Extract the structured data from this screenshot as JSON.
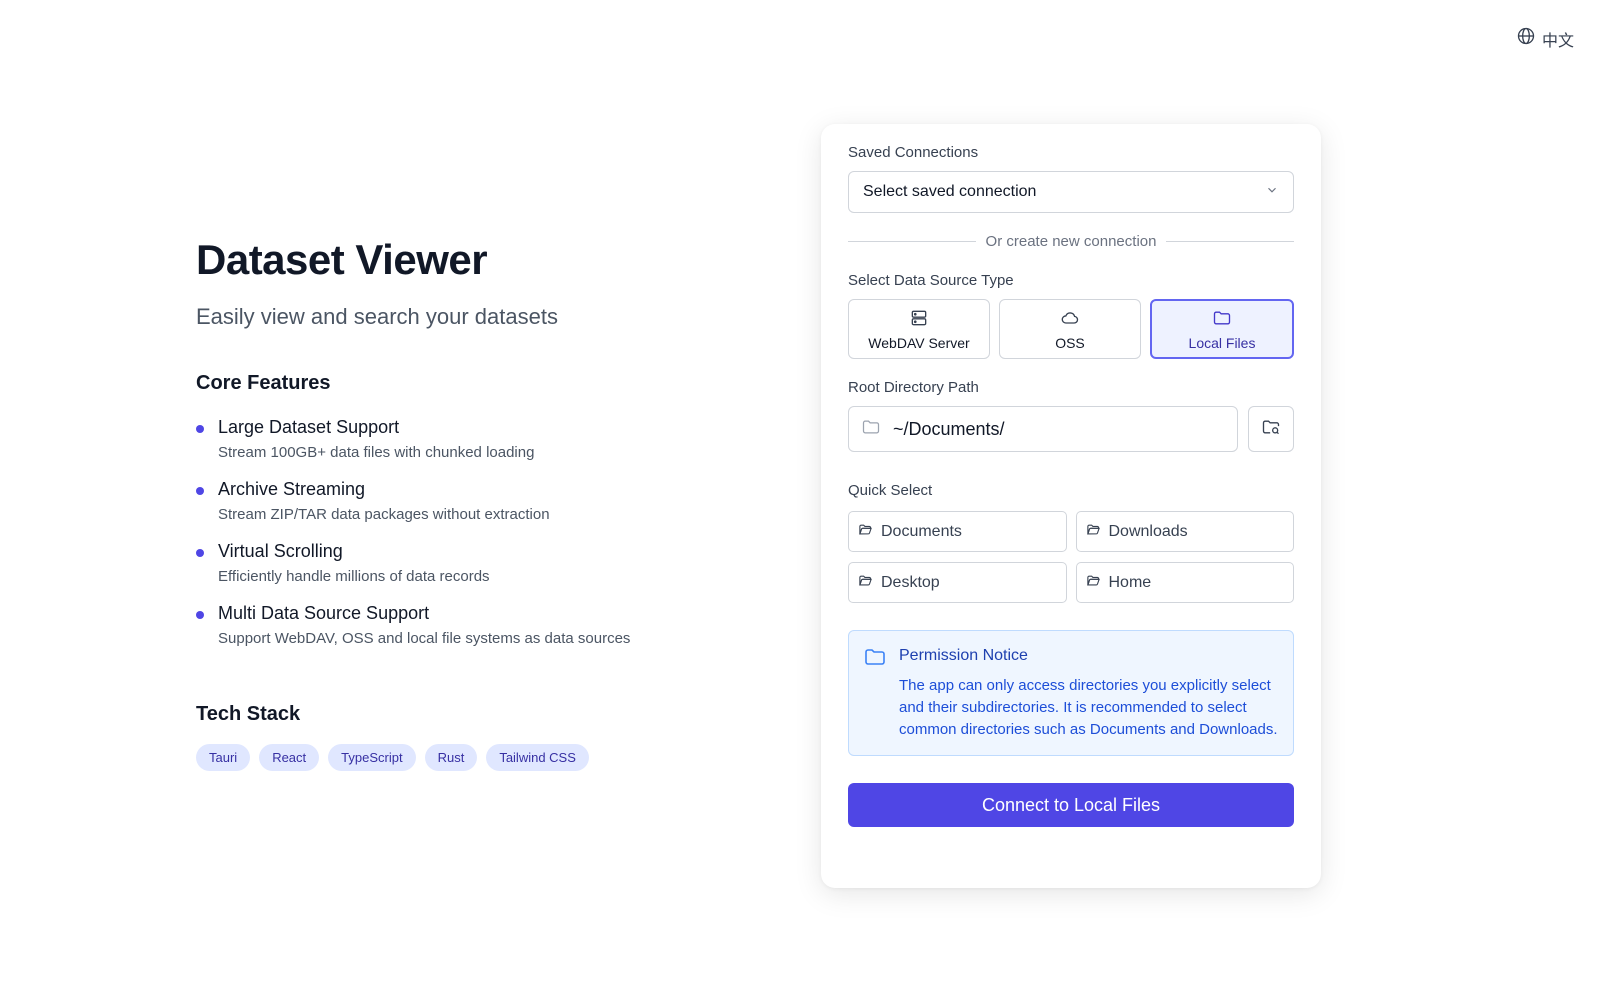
{
  "language_switch": {
    "label": "中文",
    "icon": "globe-icon"
  },
  "hero": {
    "title": "Dataset Viewer",
    "subtitle": "Easily view and search your datasets"
  },
  "features": {
    "title": "Core Features",
    "items": [
      {
        "name": "Large Dataset Support",
        "desc": "Stream 100GB+ data files with chunked loading"
      },
      {
        "name": "Archive Streaming",
        "desc": "Stream ZIP/TAR data packages without extraction"
      },
      {
        "name": "Virtual Scrolling",
        "desc": "Efficiently handle millions of data records"
      },
      {
        "name": "Multi Data Source Support",
        "desc": "Support WebDAV, OSS and local file systems as data sources"
      }
    ]
  },
  "tech_stack": {
    "title": "Tech Stack",
    "tags": [
      "Tauri",
      "React",
      "TypeScript",
      "Rust",
      "Tailwind CSS"
    ]
  },
  "connection_panel": {
    "saved_label": "Saved Connections",
    "saved_select_value": "Select saved connection",
    "divider_text": "Or create new connection",
    "type_label": "Select Data Source Type",
    "types": [
      {
        "label": "WebDAV Server",
        "icon": "server-icon",
        "selected": false
      },
      {
        "label": "OSS",
        "icon": "cloud-icon",
        "selected": false
      },
      {
        "label": "Local Files",
        "icon": "folder-icon",
        "selected": true
      }
    ],
    "path_label": "Root Directory Path",
    "path_value": "~/Documents/",
    "quick_label": "Quick Select",
    "quick_items": [
      "Documents",
      "Downloads",
      "Desktop",
      "Home"
    ],
    "notice": {
      "title": "Permission Notice",
      "text": "The app can only access directories you explicitly select and their subdirectories. It is recommended to select common directories such as Documents and Downloads."
    },
    "connect_label": "Connect to Local Files"
  },
  "colors": {
    "accent": "#4f46e5",
    "tag_bg": "#e0e7ff",
    "notice_bg": "#eff6ff",
    "notice_text": "#1d4ed8"
  }
}
